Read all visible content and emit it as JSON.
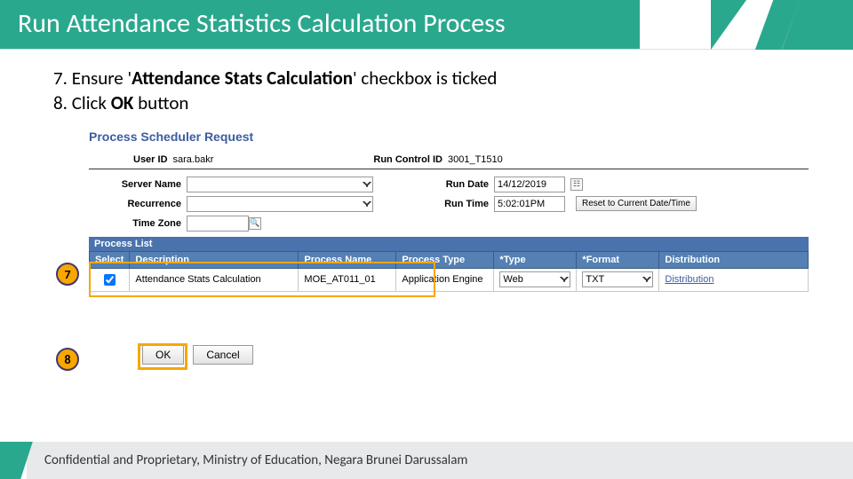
{
  "slide": {
    "title": "Run Attendance Statistics Calculation Process",
    "instruction7_num": "7. ",
    "instruction7_a": "Ensure '",
    "instruction7_bold": "Attendance Stats Calculation",
    "instruction7_b": "' checkbox is ticked",
    "instruction8_num": "8. ",
    "instruction8_a": "Click ",
    "instruction8_bold": "OK",
    "instruction8_b": " button",
    "footer": "Confidential and Proprietary, Ministry of Education, Negara Brunei Darussalam",
    "callout7": "7",
    "callout8": "8"
  },
  "psr": {
    "heading": "Process Scheduler Request",
    "labels": {
      "user_id": "User ID",
      "run_control_id": "Run Control ID",
      "server_name": "Server Name",
      "recurrence": "Recurrence",
      "time_zone": "Time Zone",
      "run_date": "Run Date",
      "run_time": "Run Time",
      "reset": "Reset to Current Date/Time",
      "process_list": "Process List"
    },
    "values": {
      "user_id": "sara.bakr",
      "run_control_id": "3001_T1510",
      "server_name": "",
      "recurrence": "",
      "time_zone": "",
      "run_date": "14/12/2019",
      "run_time": "5:02:01PM"
    },
    "columns": {
      "select": "Select",
      "description": "Description",
      "process_name": "Process Name",
      "process_type": "Process Type",
      "type": "Type",
      "format": "Format",
      "distribution": "Distribution"
    },
    "row": {
      "checked": true,
      "description": "Attendance Stats Calculation",
      "process_name": "MOE_AT011_01",
      "process_type": "Application Engine",
      "type": "Web",
      "format": "TXT",
      "distribution": "Distribution"
    },
    "buttons": {
      "ok": "OK",
      "cancel": "Cancel"
    }
  }
}
